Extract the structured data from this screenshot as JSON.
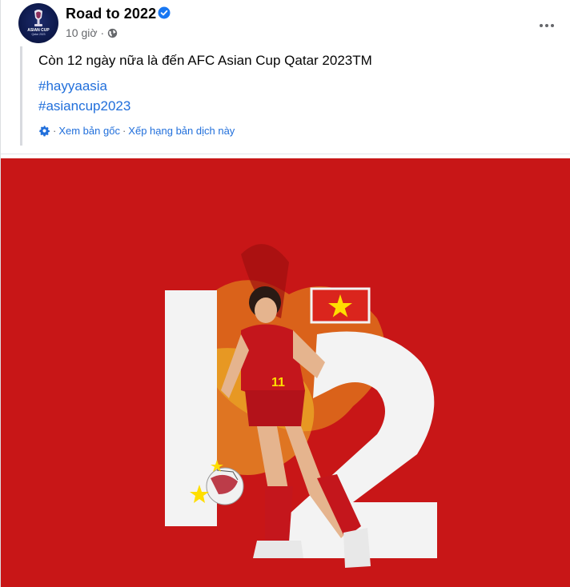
{
  "post": {
    "page_name": "Road to 2022",
    "time": "10 giờ",
    "meta_separator": "·",
    "message": "Còn 12 ngày nữa là đến AFC Asian Cup Qatar 2023TM",
    "hashtags": [
      "#hayyaasia",
      "#asiancup2023"
    ],
    "see_original": "Xem bản gốc",
    "rate_translation": "Xếp hạng bản dịch này",
    "separator": "·"
  },
  "avatar_logo": {
    "line1": "ASIAN CUP",
    "line2": "Qatar 2023"
  },
  "image": {
    "countdown": "12",
    "jersey_number": "11"
  },
  "colors": {
    "link": "#216fdb",
    "poster_red": "#c81617",
    "verified_blue": "#1877f2"
  },
  "icons": [
    "verified-badge-icon",
    "globe-icon",
    "more-options-icon",
    "gear-icon",
    "star-icon"
  ]
}
